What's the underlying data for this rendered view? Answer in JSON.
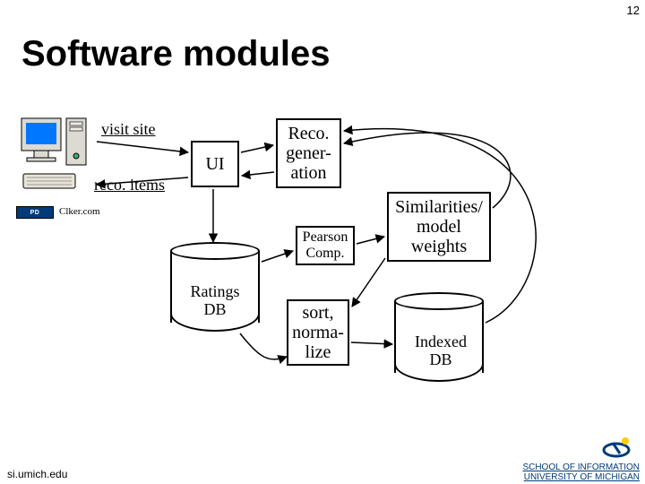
{
  "slide": {
    "number": "12",
    "title": "Software modules"
  },
  "arrows": {
    "visit": "visit site",
    "reco": "reco. items"
  },
  "nodes": {
    "ui": "UI",
    "recogen": "Reco.\ngener-\nation",
    "pearson": "Pearson\nComp.",
    "sim": "Similarities/\nmodel\nweights",
    "sort": "sort,\nnorma-\nlize"
  },
  "dbs": {
    "ratings": "Ratings\nDB",
    "indexed": "Indexed\nDB"
  },
  "credits": {
    "clker": "Clker.com"
  },
  "footer": {
    "left": "si.umich.edu",
    "right_line1": "SCHOOL OF INFORMATION",
    "right_line2": "UNIVERSITY OF MICHIGAN"
  }
}
